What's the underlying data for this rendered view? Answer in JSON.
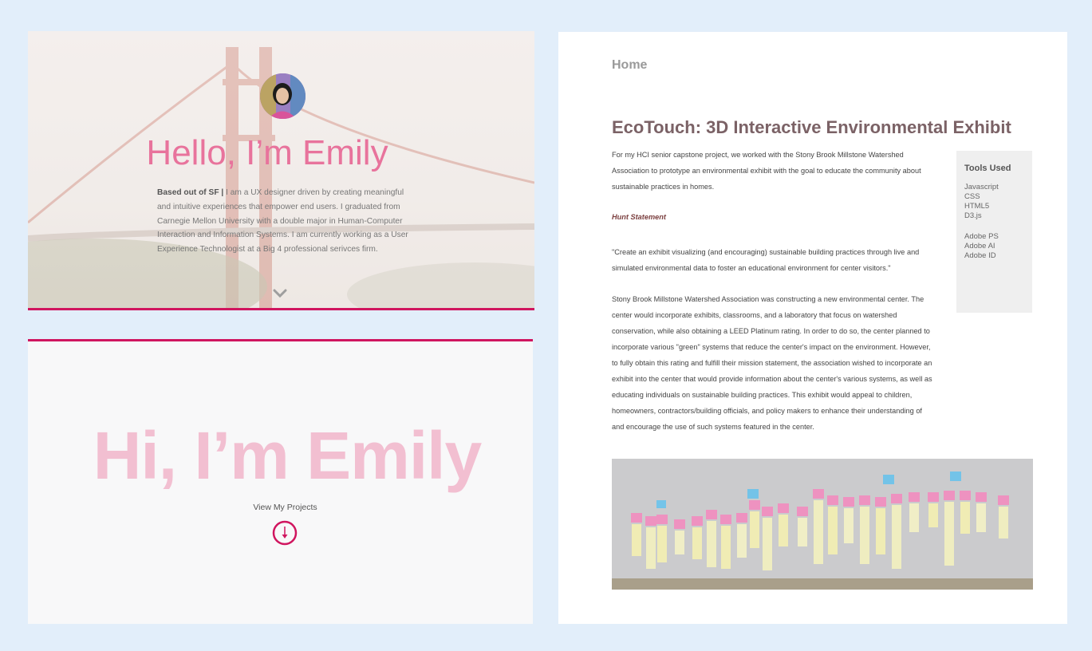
{
  "hero": {
    "title": "Hello, I’m Emily",
    "bio_bold": "Based out of SF |",
    "bio_text": " I am a UX designer driven by creating meaningful and intuitive experiences that empower end users. I graduated from Carnegie Mellon University with a double major in Human-Computer Interaction and Information Systems. I am currently working as a User Experience Technologist at a Big 4 professional serivces firm."
  },
  "lower": {
    "title": "Hi, I’m Emily",
    "view_projects": "View My Projects"
  },
  "project": {
    "home": "Home",
    "title": "EcoTouch: 3D Interactive Environmental Exhibit",
    "intro": "For my HCI senior capstone project, we worked with the Stony Brook Millstone Watershed Association to prototype an environmental exhibit with the goal to educate the community about sustainable practices in homes.",
    "hunt_label": "Hunt Statement",
    "quote": "\"Create an exhibit visualizing (and encouraging) sustainable building practices through live and simulated environmental data to foster an educational environment for center visitors.\"",
    "paragraph": "Stony Brook Millstone Watershed Association was constructing a new environmental center. The center would incorporate exhibits, classrooms, and a laboratory that focus on watershed conservation, while also obtaining a LEED Platinum rating. In order to do so, the center planned to incorporate various \"green\" systems that reduce the center's impact on the environment. However, to fully obtain this rating and fulfill their mission statement, the association wished to incorporate an exhibit into the center that would provide information about the center's various systems, as well as educating individuals on sustainable building practices. This exhibit would appeal to children, homeowners, contractors/building officials, and policy makers to enhance their understanding of and encourage the use of such systems featured in the center.",
    "tools": {
      "title": "Tools Used",
      "group1": [
        "Javascript",
        "CSS",
        "HTML5",
        "D3.js"
      ],
      "group2": [
        "Adobe PS",
        "Adobe AI",
        "Adobe ID"
      ]
    }
  },
  "colors": {
    "background": "#e2eefa",
    "accent": "#d0155f",
    "hero_title": "#e8739c",
    "lower_title": "#f2bfd1",
    "project_title": "#7b6266"
  },
  "icons": {
    "chevron": "chevron-down-icon",
    "down_arrow": "arrow-down-circle-icon"
  }
}
